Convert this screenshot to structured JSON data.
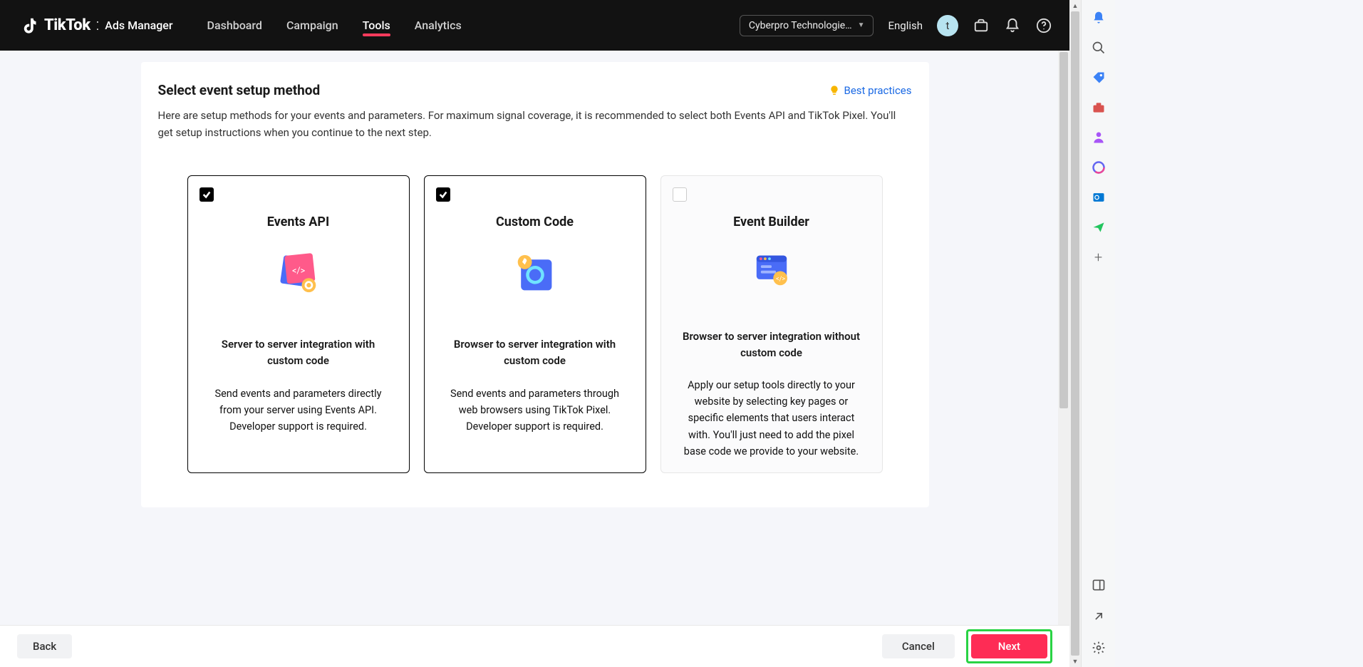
{
  "brand": {
    "name": "TikTok",
    "sep": ":",
    "sub": "Ads Manager"
  },
  "nav": {
    "tabs": [
      {
        "label": "Dashboard"
      },
      {
        "label": "Campaign"
      },
      {
        "label": "Tools"
      },
      {
        "label": "Analytics"
      }
    ],
    "account": "Cyberpro Technologie…",
    "language": "English",
    "avatar_initial": "t"
  },
  "page": {
    "title": "Select event setup method",
    "description": "Here are setup methods for your events and parameters. For maximum signal coverage, it is recommended to select both Events API and TikTok Pixel. You'll get setup instructions when you continue to the next step.",
    "best_practices": "Best practices"
  },
  "options": [
    {
      "title": "Events API",
      "subtitle": "Server to server integration with custom code",
      "desc": "Send events and parameters directly from your server using Events API. Developer support is required.",
      "checked": true
    },
    {
      "title": "Custom Code",
      "subtitle": "Browser to server integration with custom code",
      "desc": "Send events and parameters through web browsers using TikTok Pixel. Developer support is required.",
      "checked": true
    },
    {
      "title": "Event Builder",
      "subtitle": "Browser to server integration without custom code",
      "desc": "Apply our setup tools directly to your website by selecting key pages or specific elements that users interact with. You'll just need to add the pixel base code we provide to your website.",
      "checked": false
    }
  ],
  "footer": {
    "back": "Back",
    "cancel": "Cancel",
    "next": "Next"
  }
}
